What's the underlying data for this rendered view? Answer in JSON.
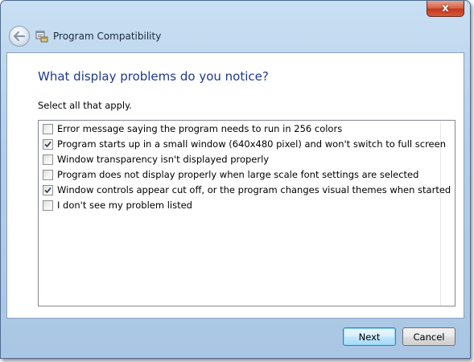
{
  "window": {
    "title": "Program Compatibility",
    "close_glyph": "x"
  },
  "icons": {
    "back": "back-arrow-icon",
    "app": "program-compatibility-icon",
    "checkmark": "checkmark-icon"
  },
  "page": {
    "heading": "What display problems do you notice?",
    "instruction": "Select all that apply."
  },
  "options": [
    {
      "label": "Error message saying the program needs to run in 256 colors",
      "checked": false
    },
    {
      "label": "Program starts up in a small window (640x480 pixel) and won't switch to full screen",
      "checked": true
    },
    {
      "label": "Window transparency isn't displayed properly",
      "checked": false
    },
    {
      "label": "Program does not display properly when large scale font settings are selected",
      "checked": false
    },
    {
      "label": "Window controls appear cut off, or the program changes visual themes when started",
      "checked": true
    },
    {
      "label": "I don't see my problem listed",
      "checked": false
    }
  ],
  "buttons": {
    "next": "Next",
    "cancel": "Cancel"
  },
  "colors": {
    "heading": "#1e3a8a",
    "close_button": "#c4381d",
    "default_button_border": "#3c7fb1"
  }
}
